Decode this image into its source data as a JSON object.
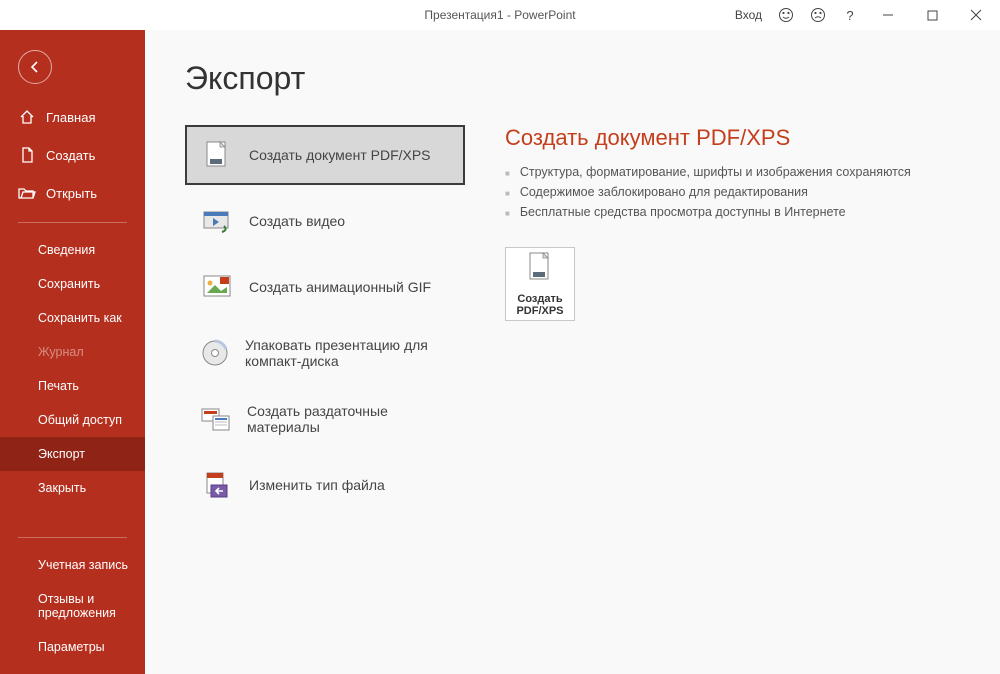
{
  "titlebar": {
    "title": "Презентация1 - PowerPoint",
    "signin": "Вход"
  },
  "sidebar": {
    "top": [
      {
        "key": "home",
        "label": "Главная",
        "icon": "home"
      },
      {
        "key": "create",
        "label": "Создать",
        "icon": "file"
      },
      {
        "key": "open",
        "label": "Открыть",
        "icon": "folder"
      }
    ],
    "mid": [
      {
        "key": "info",
        "label": "Сведения"
      },
      {
        "key": "save",
        "label": "Сохранить"
      },
      {
        "key": "saveas",
        "label": "Сохранить как"
      },
      {
        "key": "history",
        "label": "Журнал",
        "disabled": true
      },
      {
        "key": "print",
        "label": "Печать"
      },
      {
        "key": "share",
        "label": "Общий доступ"
      },
      {
        "key": "export",
        "label": "Экспорт",
        "active": true
      },
      {
        "key": "close",
        "label": "Закрыть"
      }
    ],
    "bottom": [
      {
        "key": "account",
        "label": "Учетная запись"
      },
      {
        "key": "feedback",
        "label": "Отзывы и предложения"
      },
      {
        "key": "options",
        "label": "Параметры"
      }
    ]
  },
  "page": {
    "title": "Экспорт"
  },
  "exportItems": [
    {
      "key": "pdf",
      "label": "Создать документ PDF/XPS",
      "selected": true
    },
    {
      "key": "video",
      "label": "Создать видео"
    },
    {
      "key": "gif",
      "label": "Создать анимационный GIF"
    },
    {
      "key": "cd",
      "label": "Упаковать презентацию для компакт-диска"
    },
    {
      "key": "handout",
      "label": "Создать раздаточные материалы"
    },
    {
      "key": "filetype",
      "label": "Изменить тип файла"
    }
  ],
  "detail": {
    "title": "Создать документ PDF/XPS",
    "bullets": [
      "Структура, форматирование, шрифты и изображения сохраняются",
      "Содержимое заблокировано для редактирования",
      "Бесплатные средства просмотра доступны в Интернете"
    ],
    "actionLabel": "Создать PDF/XPS"
  }
}
